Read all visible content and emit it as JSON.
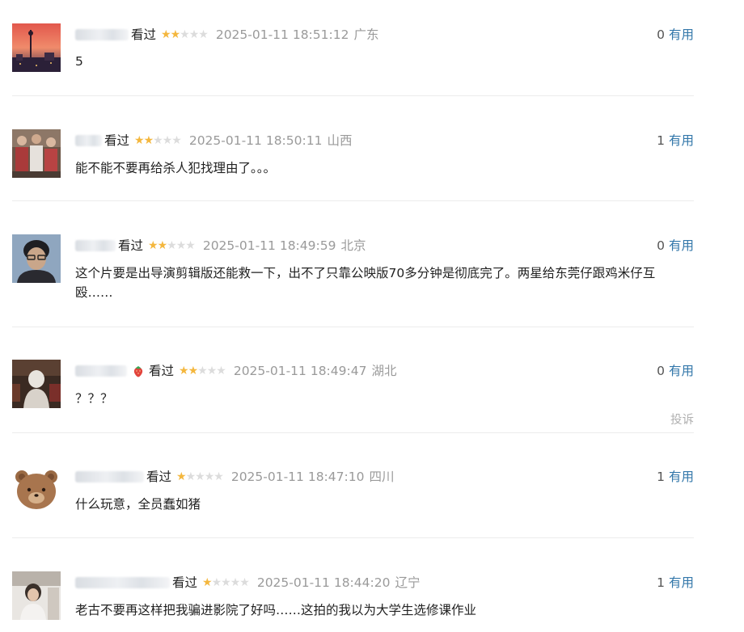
{
  "comments": [
    {
      "status": "看过",
      "rating": 2,
      "time": "2025-01-11 18:51:12",
      "location": "广东",
      "votes": "0",
      "useful_label": "有用",
      "text": "5"
    },
    {
      "status": "看过",
      "rating": 2,
      "time": "2025-01-11 18:50:11",
      "location": "山西",
      "votes": "1",
      "useful_label": "有用",
      "text": "能不能不要再给杀人犯找理由了。。。"
    },
    {
      "status": "看过",
      "rating": 2,
      "time": "2025-01-11 18:49:59",
      "location": "北京",
      "votes": "0",
      "useful_label": "有用",
      "text": "这个片要是出导演剪辑版还能救一下，出不了只靠公映版70多分钟是彻底完了。两星给东莞仔跟鸡米仔互殴……"
    },
    {
      "status": "看过",
      "rating": 2,
      "time": "2025-01-11 18:49:47",
      "location": "湖北",
      "votes": "0",
      "useful_label": "有用",
      "text": "？？？",
      "report_label": "投诉"
    },
    {
      "status": "看过",
      "rating": 1,
      "time": "2025-01-11 18:47:10",
      "location": "四川",
      "votes": "1",
      "useful_label": "有用",
      "text": "什么玩意，全员蠢如猪"
    },
    {
      "status": "看过",
      "rating": 1,
      "time": "2025-01-11 18:44:20",
      "location": "辽宁",
      "votes": "1",
      "useful_label": "有用",
      "text": "老古不要再这样把我骗进影院了好吗……这拍的我以为大学生选修课作业"
    }
  ],
  "icons": {
    "star": "star-icon",
    "badge": "strawberry-icon"
  },
  "colors": {
    "star_on": "#f4b73e",
    "star_off": "#dcdcdc",
    "link": "#3377aa",
    "meta_gray": "#9a9a9a"
  }
}
